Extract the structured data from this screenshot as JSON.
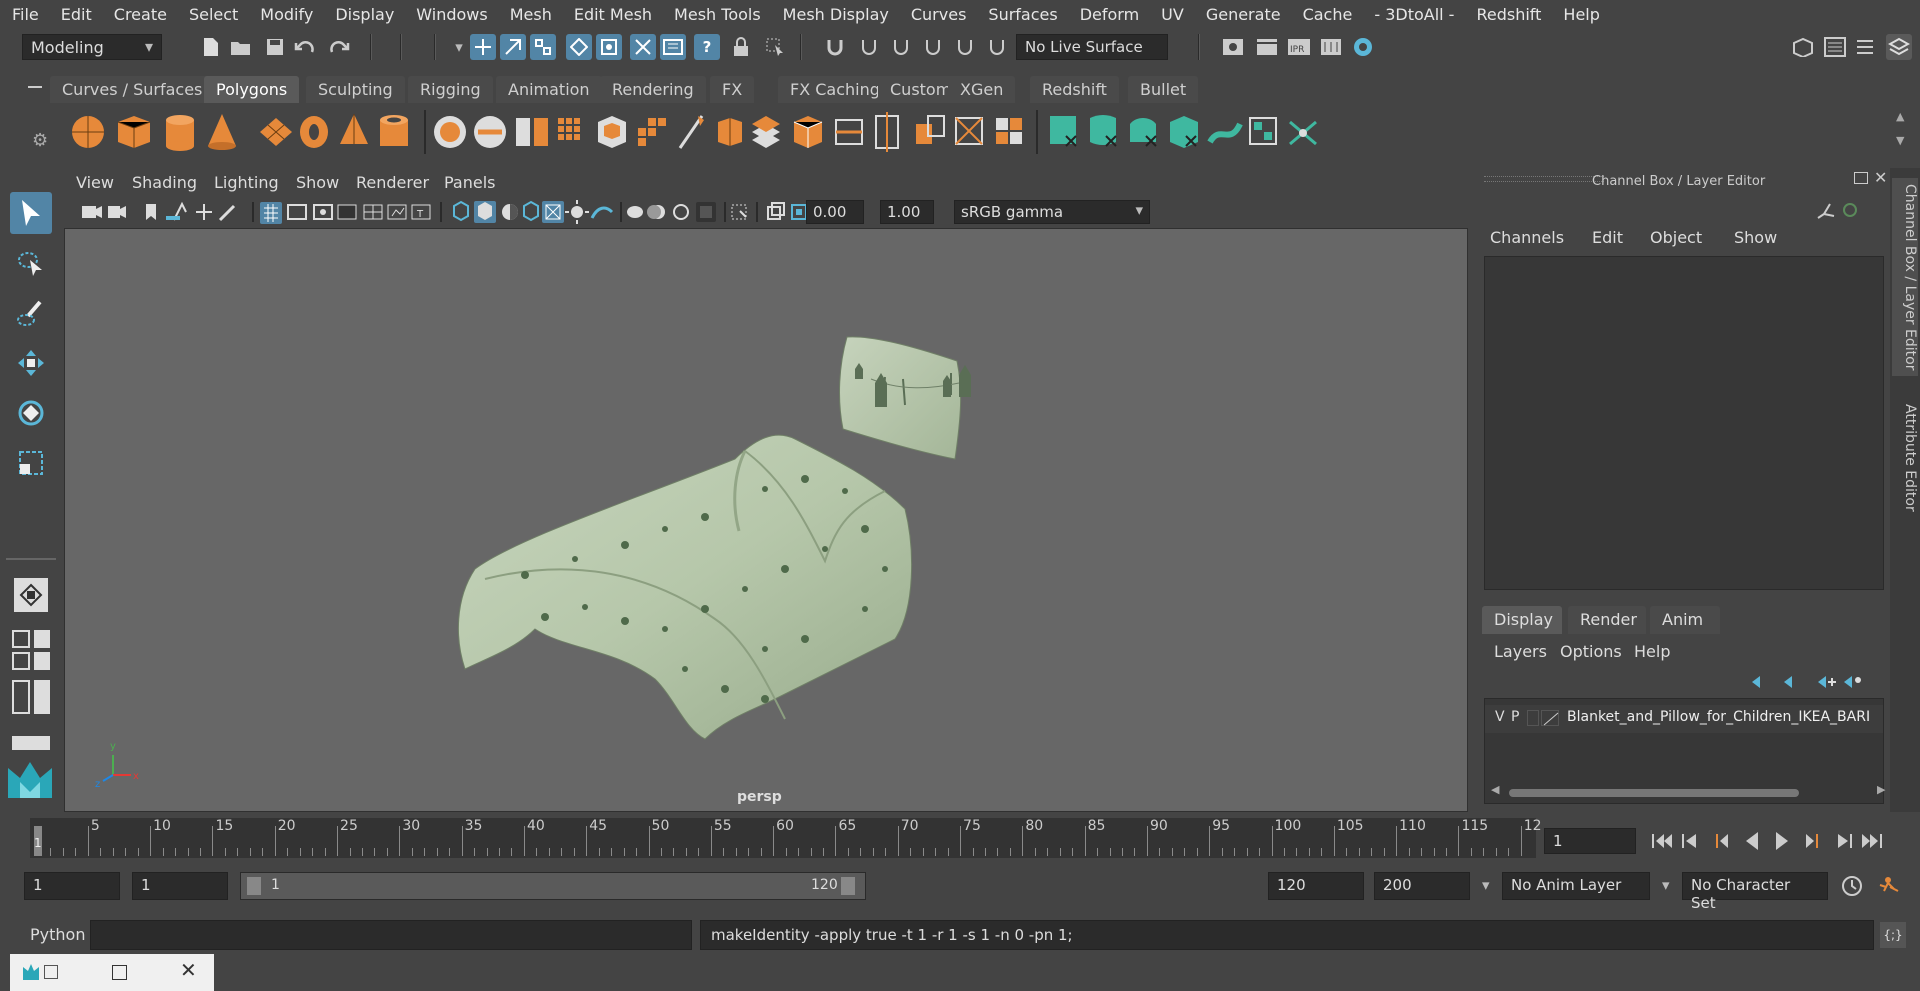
{
  "menubar": {
    "items": [
      "File",
      "Edit",
      "Create",
      "Select",
      "Modify",
      "Display",
      "Windows",
      "Mesh",
      "Edit Mesh",
      "Mesh Tools",
      "Mesh Display",
      "Curves",
      "Surfaces",
      "Deform",
      "UV",
      "Generate",
      "Cache",
      "- 3DtoAll -",
      "Redshift",
      "Help"
    ]
  },
  "statusline": {
    "mode": "Modeling",
    "live_surface": "No Live Surface"
  },
  "shelf": {
    "tabs": [
      "Curves / Surfaces",
      "Polygons",
      "Sculpting",
      "Rigging",
      "Animation",
      "Rendering",
      "FX",
      "FX Caching",
      "Custom",
      "XGen",
      "Redshift",
      "Bullet"
    ],
    "active_tab": "Polygons"
  },
  "viewport": {
    "menu": [
      "View",
      "Shading",
      "Lighting",
      "Show",
      "Renderer",
      "Panels"
    ],
    "exposure": "0.00",
    "gamma": "1.00",
    "color_space": "sRGB gamma",
    "camera_label": "persp",
    "axis_x": "x",
    "axis_y": "y",
    "axis_z": "z"
  },
  "channel_box": {
    "title": "Channel Box / Layer Editor",
    "menu": [
      "Channels",
      "Edit",
      "Object",
      "Show"
    ]
  },
  "layer_editor": {
    "tabs": [
      "Display",
      "Render",
      "Anim"
    ],
    "active_tab": "Display",
    "menu": [
      "Layers",
      "Options",
      "Help"
    ],
    "layer": {
      "visible": "V",
      "playback": "P",
      "name": "Blanket_and_Pillow_for_Children_IKEA_BARI"
    }
  },
  "side_tabs": [
    "Channel Box / Layer Editor",
    "Attribute Editor"
  ],
  "timeline": {
    "ticks": [
      "5",
      "10",
      "15",
      "20",
      "25",
      "30",
      "35",
      "40",
      "45",
      "50",
      "55",
      "60",
      "65",
      "70",
      "75",
      "80",
      "85",
      "90",
      "95",
      "100",
      "105",
      "110",
      "115",
      "12"
    ],
    "current_marker": "1",
    "current_frame": "1"
  },
  "range": {
    "start": "1",
    "playback_start": "1",
    "slider_start": "1",
    "slider_end": "120",
    "playback_end": "120",
    "end": "200",
    "anim_layer": "No Anim Layer",
    "character_set": "No Character Set"
  },
  "command_line": {
    "language": "Python",
    "result": "makeIdentity -apply true -t 1 -r 1 -s 1 -n 0 -pn 1;"
  }
}
